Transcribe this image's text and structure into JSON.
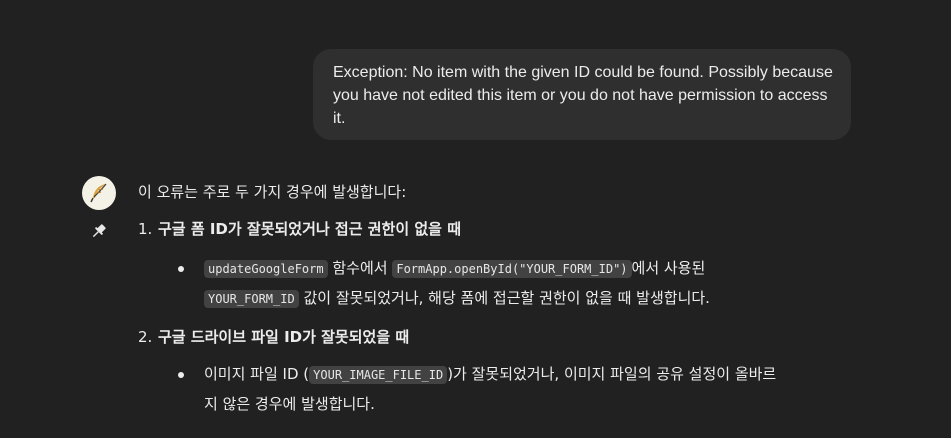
{
  "user_message": {
    "text": "Exception: No item with the given ID could be found. Possibly because you have not edited this item or you do not have permission to access it."
  },
  "assistant": {
    "avatar_icon": "feather-logo-icon",
    "pin_icon": "pushpin-icon",
    "intro": "이 오류는 주로 두 가지 경우에 발생합니다:",
    "items": [
      {
        "number": "1.",
        "title": "구글 폼 ID가 잘못되었거나 접근 권한이 없을 때",
        "bullet": {
          "code1": "updateGoogleForm",
          "text1": " 함수에서 ",
          "code2": "FormApp.openById(\"YOUR_FORM_ID\")",
          "text2": "에서 사용된",
          "code3": "YOUR_FORM_ID",
          "text3": " 값이 잘못되었거나, 해당 폼에 접근할 권한이 없을 때 발생합니다."
        }
      },
      {
        "number": "2.",
        "title": "구글 드라이브 파일 ID가 잘못되었을 때",
        "bullet": {
          "text1": "이미지 파일 ID (",
          "code1": "YOUR_IMAGE_FILE_ID",
          "text2": ")가 잘못되었거나, 이미지 파일의 공유 설정이 올바르",
          "text3": "지 않은 경우에 발생합니다."
        }
      }
    ]
  }
}
